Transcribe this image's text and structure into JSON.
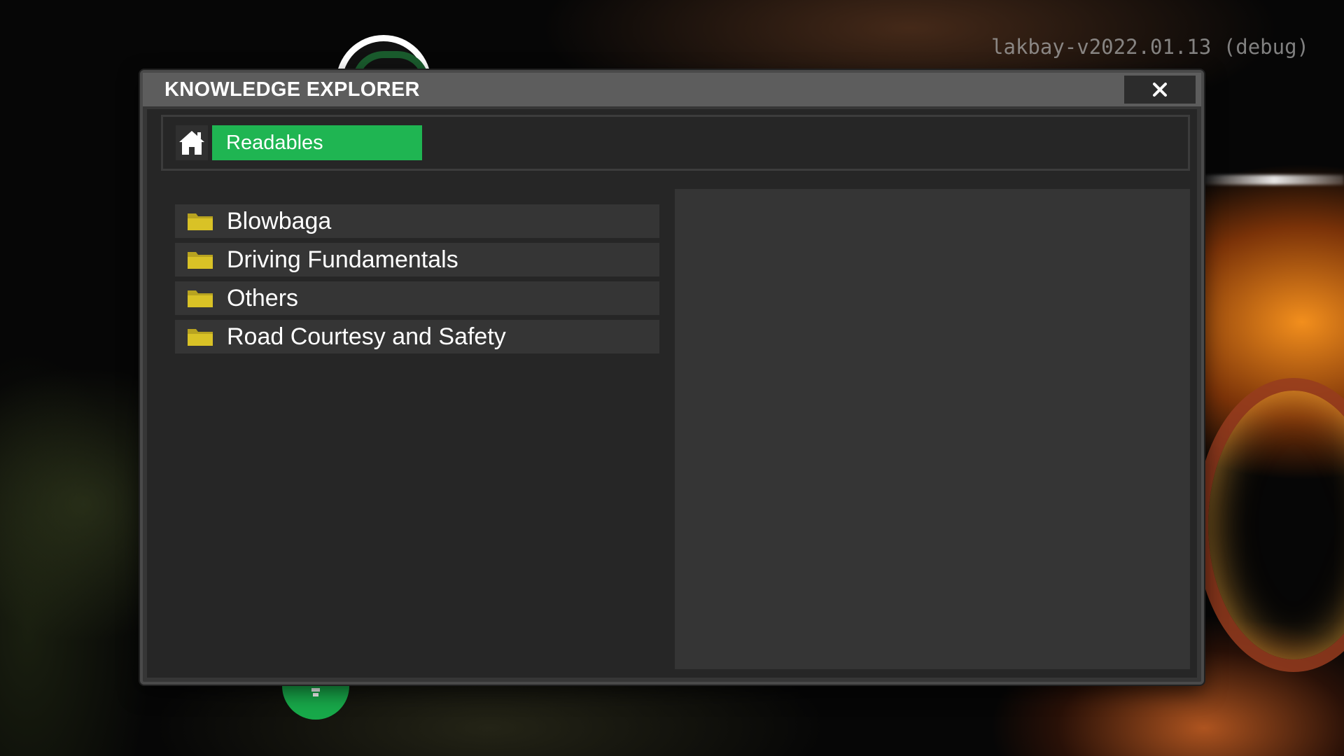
{
  "version_text": "lakbay-v2022.01.13 (debug)",
  "dialog": {
    "title": "KNOWLEDGE EXPLORER",
    "close_icon": "close-icon"
  },
  "nav": {
    "home_icon": "home-icon",
    "breadcrumb": "Readables"
  },
  "folders": [
    {
      "label": "Blowbaga",
      "icon": "folder-icon"
    },
    {
      "label": "Driving Fundamentals",
      "icon": "folder-icon"
    },
    {
      "label": "Others",
      "icon": "folder-icon"
    },
    {
      "label": "Road Courtesy and Safety",
      "icon": "folder-icon"
    }
  ],
  "colors": {
    "accent_green": "#1fb552",
    "folder_yellow": "#d9c226",
    "titlebar": "#5d5d5d",
    "panel_dark": "#262626",
    "panel_mid": "#353535"
  }
}
